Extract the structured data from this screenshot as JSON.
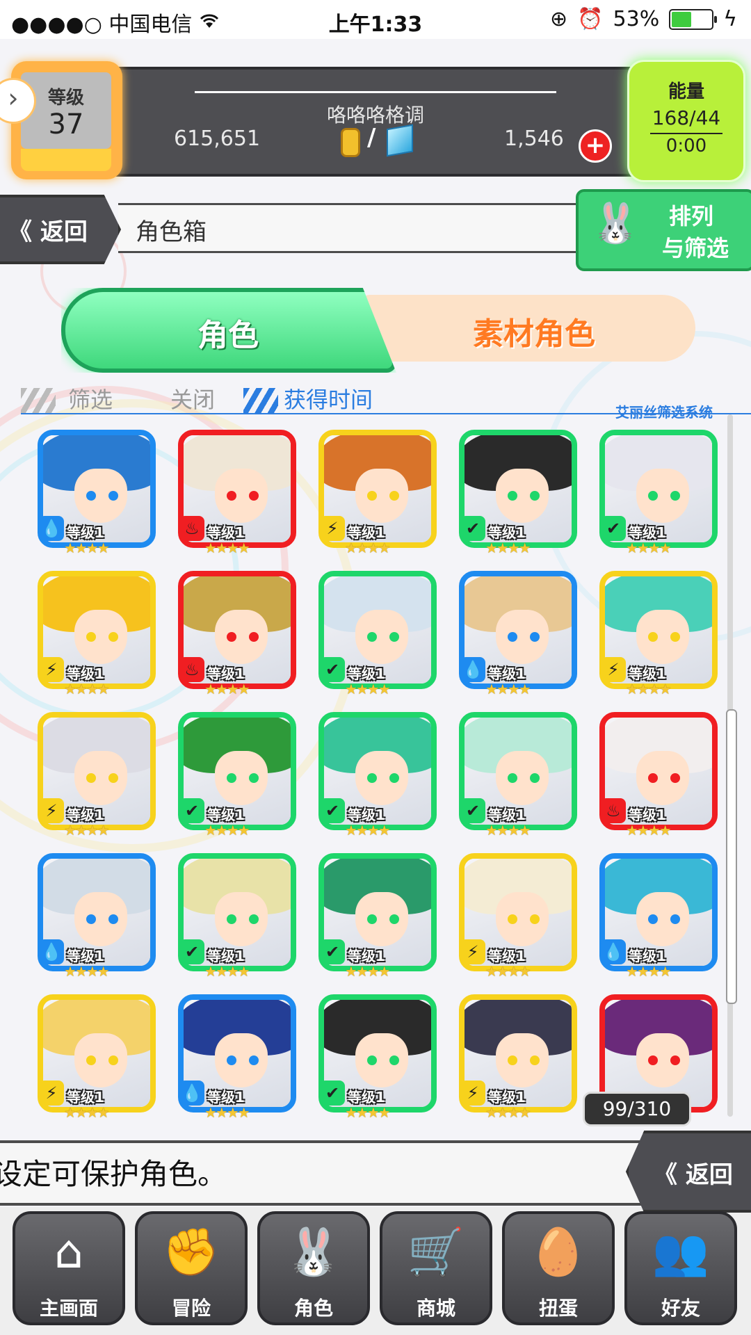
{
  "status_bar": {
    "carrier": "●●●●○ 中国电信",
    "time": "上午1:33",
    "battery_percent": "53%",
    "battery_level": 0.53
  },
  "header": {
    "level_label": "等级",
    "level_value": "37",
    "player_name": "咯咯咯格调",
    "gold": "615,651",
    "gems": "1,546",
    "slash": "/",
    "plus": "+",
    "energy_label": "能量",
    "energy_value": "168/44",
    "energy_timer": "0:00"
  },
  "title_bar": {
    "back_label": "《 返回",
    "title": "角色箱",
    "sort_label_line1": "排列",
    "sort_label_line2": "与筛选"
  },
  "tabs": {
    "characters": "角色",
    "material_characters": "素材角色"
  },
  "filter": {
    "filter_label": "筛选",
    "filter_value": "关闭",
    "sort_value": "获得时间",
    "system_label": "艾丽丝筛选系统"
  },
  "colors": {
    "water": "#1e8bf0",
    "fire": "#f01e22",
    "thunder": "#f7d21c",
    "wood": "#1ed66a"
  },
  "cards": [
    {
      "element": "water",
      "level": "等级1",
      "stars": 4,
      "hair": "#2a7bd0"
    },
    {
      "element": "fire",
      "level": "等级1",
      "stars": 4,
      "hair": "#efe6d6"
    },
    {
      "element": "thunder",
      "level": "等级1",
      "stars": 4,
      "hair": "#d8732a"
    },
    {
      "element": "wood",
      "level": "等级1",
      "stars": 4,
      "hair": "#2a2a2a"
    },
    {
      "element": "wood",
      "level": "等级1",
      "stars": 4,
      "hair": "#e6e6ee"
    },
    {
      "element": "thunder",
      "level": "等级1",
      "stars": 4,
      "hair": "#f6c21e"
    },
    {
      "element": "fire",
      "level": "等级1",
      "stars": 4,
      "hair": "#c9a84a"
    },
    {
      "element": "wood",
      "level": "等级1",
      "stars": 4,
      "hair": "#d4e2ee"
    },
    {
      "element": "water",
      "level": "等级1",
      "stars": 4,
      "hair": "#e8c894"
    },
    {
      "element": "thunder",
      "level": "等级1",
      "stars": 4,
      "hair": "#4ad0b8"
    },
    {
      "element": "thunder",
      "level": "等级1",
      "stars": 4,
      "hair": "#dcdce4"
    },
    {
      "element": "wood",
      "level": "等级1",
      "stars": 4,
      "hair": "#2e9a3a"
    },
    {
      "element": "wood",
      "level": "等级1",
      "stars": 4,
      "hair": "#38c49a"
    },
    {
      "element": "wood",
      "level": "等级1",
      "stars": 4,
      "hair": "#b8ead8"
    },
    {
      "element": "fire",
      "level": "等级1",
      "stars": 4,
      "hair": "#f2eeee"
    },
    {
      "element": "water",
      "level": "等级1",
      "stars": 4,
      "hair": "#d2dce6"
    },
    {
      "element": "wood",
      "level": "等级1",
      "stars": 4,
      "hair": "#e8e2a8"
    },
    {
      "element": "wood",
      "level": "等级1",
      "stars": 4,
      "hair": "#2a9a6a"
    },
    {
      "element": "thunder",
      "level": "等级1",
      "stars": 4,
      "hair": "#f4ecd4"
    },
    {
      "element": "water",
      "level": "等级1",
      "stars": 4,
      "hair": "#3ab8d6"
    },
    {
      "element": "thunder",
      "level": "等级1",
      "stars": 4,
      "hair": "#f4d26a"
    },
    {
      "element": "water",
      "level": "等级1",
      "stars": 4,
      "hair": "#243e96"
    },
    {
      "element": "wood",
      "level": "等级1",
      "stars": 4,
      "hair": "#2a2a2a"
    },
    {
      "element": "thunder",
      "level": "等级1",
      "stars": 4,
      "hair": "#3a3a50"
    },
    {
      "element": "fire",
      "level": "",
      "stars": 0,
      "hair": "#6a2a7a"
    }
  ],
  "element_icons": {
    "water": "💧",
    "fire": "♨",
    "thunder": "⚡",
    "wood": "✔"
  },
  "card_count": "99/310",
  "message": "设定可保护角色。",
  "back_label_bottom": "《 返回",
  "nav": [
    {
      "label": "主画面",
      "icon": "home-icon",
      "glyph": "⌂"
    },
    {
      "label": "冒险",
      "icon": "handshake-icon",
      "glyph": "✊"
    },
    {
      "label": "角色",
      "icon": "bunny-icon",
      "glyph": "🐰"
    },
    {
      "label": "商城",
      "icon": "cart-icon",
      "glyph": "🛒"
    },
    {
      "label": "扭蛋",
      "icon": "egg-icon",
      "glyph": "🥚"
    },
    {
      "label": "好友",
      "icon": "friends-icon",
      "glyph": "👥"
    }
  ]
}
